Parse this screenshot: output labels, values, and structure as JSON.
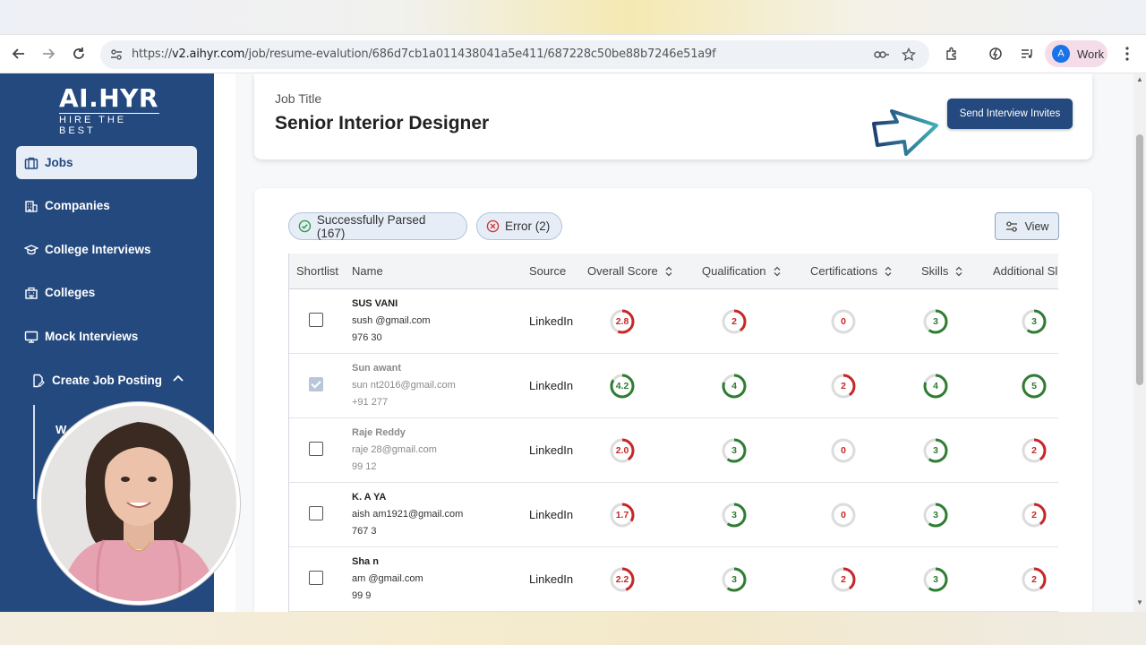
{
  "browser": {
    "url_prefix": "https://",
    "url_host": "v2.aihyr.com",
    "url_path": "/job/resume-evalution/686d7cb1a011438041a5e411/687228c50be88b7246e51a9f",
    "profile_initial": "A",
    "profile_label": "Work"
  },
  "brand": {
    "logo_main": "AI.HYR",
    "logo_tagline": "HIRE THE BEST"
  },
  "sidebar": {
    "items": [
      {
        "label": "Jobs",
        "icon": "briefcase-icon",
        "active": true
      },
      {
        "label": "Companies",
        "icon": "building-icon"
      },
      {
        "label": "College Interviews",
        "icon": "graduation-cap-icon"
      },
      {
        "label": "Colleges",
        "icon": "college-building-icon"
      },
      {
        "label": "Mock Interviews",
        "icon": "monitor-icon"
      },
      {
        "label": "Create Job Posting",
        "icon": "document-edit-icon",
        "expanded": true
      }
    ],
    "sub_item_partial": "W"
  },
  "job": {
    "title_label": "Job Title",
    "title_value": "Senior Interior Designer",
    "invite_button": "Send Interview Invites"
  },
  "filters": {
    "parsed": "Successfully Parsed (167)",
    "error": "Error (2)",
    "view": "View"
  },
  "table": {
    "headers": [
      "Shortlist",
      "Name",
      "Source",
      "Overall Score",
      "Qualification",
      "Certifications",
      "Skills",
      "Additional Sl"
    ],
    "rows": [
      {
        "checked": false,
        "faded": false,
        "name": "SUS VANI",
        "email": "sush @gmail.com",
        "phone": "976 30",
        "source": "LinkedIn",
        "scores": [
          "2.8",
          "2",
          "0",
          "3",
          "3"
        ],
        "colors": [
          "red",
          "red",
          "gray",
          "green",
          "green"
        ]
      },
      {
        "checked": true,
        "faded": true,
        "name": "Sun awant",
        "email": "sun nt2016@gmail.com",
        "phone": "+91 277",
        "source": "LinkedIn",
        "scores": [
          "4.2",
          "4",
          "2",
          "4",
          "5"
        ],
        "colors": [
          "green",
          "green",
          "red",
          "green",
          "green"
        ]
      },
      {
        "checked": false,
        "faded": true,
        "name": "Raje Reddy",
        "email": "raje 28@gmail.com",
        "phone": "99 12",
        "source": "LinkedIn",
        "scores": [
          "2.0",
          "3",
          "0",
          "3",
          "2"
        ],
        "colors": [
          "red",
          "green",
          "gray",
          "green",
          "red"
        ]
      },
      {
        "checked": false,
        "faded": false,
        "name": "K. A YA",
        "email": "aish am1921@gmail.com",
        "phone": "767 3",
        "source": "LinkedIn",
        "scores": [
          "1.7",
          "3",
          "0",
          "3",
          "2"
        ],
        "colors": [
          "red",
          "green",
          "gray",
          "green",
          "red"
        ]
      },
      {
        "checked": false,
        "faded": false,
        "name": "Sha n",
        "email": "am @gmail.com",
        "phone": "99 9",
        "source": "LinkedIn",
        "scores": [
          "2.2",
          "3",
          "2",
          "3",
          "2"
        ],
        "colors": [
          "red",
          "green",
          "red",
          "green",
          "red"
        ]
      }
    ]
  },
  "colors": {
    "sidebar": "#24497f",
    "score_green": "#2e7d32",
    "score_red": "#c62828",
    "score_gray": "#bdbdbd"
  }
}
